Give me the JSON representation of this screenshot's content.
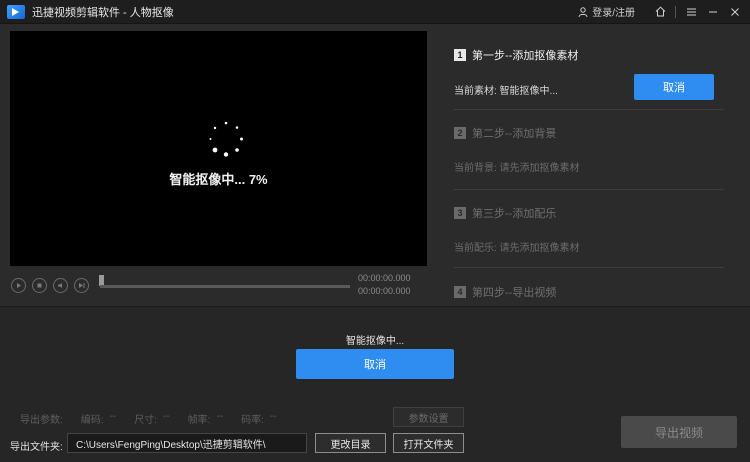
{
  "window": {
    "title": "迅捷视频剪辑软件 - 人物抠像",
    "login_label": "登录/注册",
    "icons": [
      "user-icon",
      "home-icon",
      "menu-icon",
      "minimize-icon",
      "close-icon"
    ]
  },
  "preview": {
    "progress_text": "智能抠像中... 7%",
    "current_time": "00:00:00.000",
    "total_time": "00:00:00.000",
    "progress_percent": 7
  },
  "steps": [
    {
      "num": "1",
      "title": "第一步--添加抠像素材",
      "line": "当前素材: 智能抠像中...",
      "active": true,
      "button": "取消"
    },
    {
      "num": "2",
      "title": "第二步--添加背景",
      "line": "当前背景: 请先添加抠像素材",
      "active": false
    },
    {
      "num": "3",
      "title": "第三步--添加配乐",
      "line": "当前配乐: 请先添加抠像素材",
      "active": false
    },
    {
      "num": "4",
      "title": "第四步--导出视频",
      "active": false
    }
  ],
  "status": {
    "text": "智能抠像中...",
    "cancel_label": "取消"
  },
  "export": {
    "params_label": "导出参数:",
    "codec_label": "编码:",
    "codec_value": "--",
    "size_label": "尺寸:",
    "size_value": "--",
    "fps_label": "帧率:",
    "fps_value": "--",
    "bitrate_label": "码率:",
    "bitrate_value": "--",
    "param_settings_label": "参数设置",
    "folder_label": "导出文件夹:",
    "folder_path": "C:\\Users\\FengPing\\Desktop\\迅捷剪辑软件\\",
    "change_dir_label": "更改目录",
    "open_folder_label": "打开文件夹",
    "export_label": "导出视频"
  }
}
